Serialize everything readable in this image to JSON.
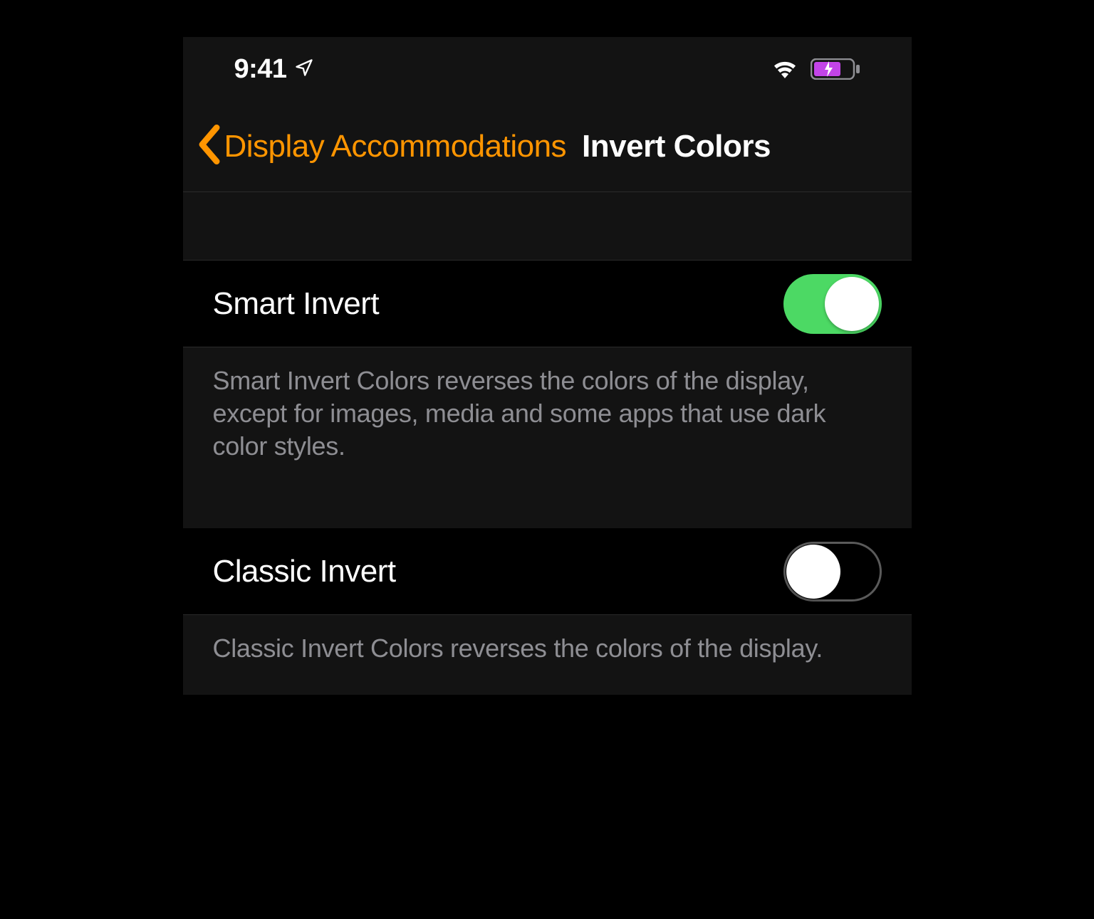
{
  "statusBar": {
    "time": "9:41"
  },
  "nav": {
    "backLabel": "Display Accommodations",
    "title": "Invert Colors"
  },
  "settings": {
    "smartInvert": {
      "label": "Smart Invert",
      "enabled": true,
      "description": "Smart Invert Colors reverses the colors of the display, except for images, media and some apps that use dark color styles."
    },
    "classicInvert": {
      "label": "Classic Invert",
      "enabled": false,
      "description": "Classic Invert Colors reverses the colors of the display."
    }
  },
  "colors": {
    "accent": "#ff9500",
    "toggleOn": "#4cd964",
    "batteryFill": "#c344e8"
  }
}
